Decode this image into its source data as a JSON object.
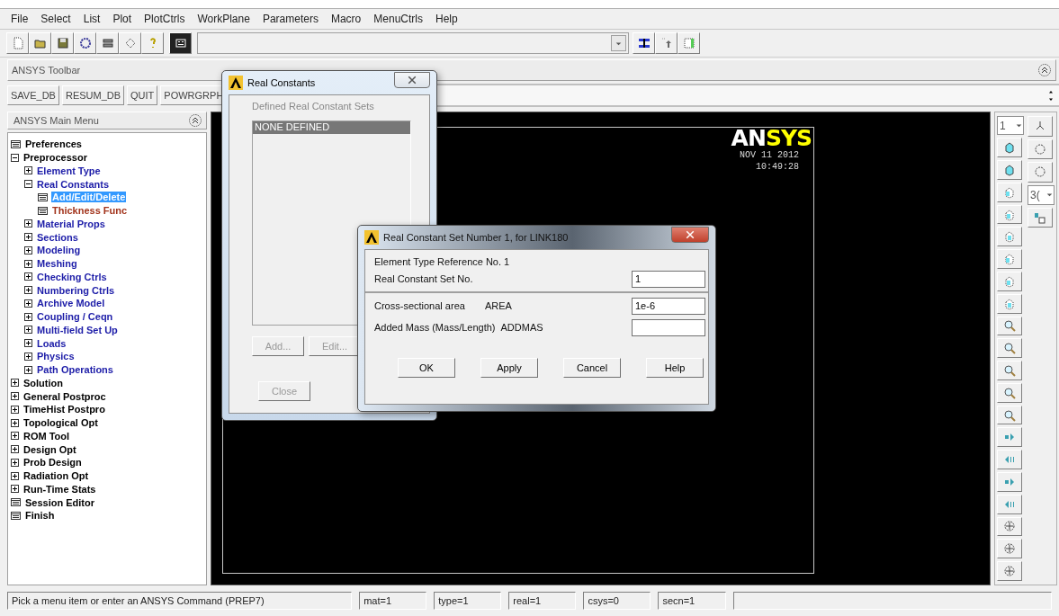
{
  "menu_bar": [
    "File",
    "Select",
    "List",
    "Plot",
    "PlotCtrls",
    "WorkPlane",
    "Parameters",
    "Macro",
    "MenuCtrls",
    "Help"
  ],
  "toolbar_header": "ANSYS Toolbar",
  "toolbar_buttons": [
    "SAVE_DB",
    "RESUM_DB",
    "QUIT",
    "POWRGRPH"
  ],
  "main_menu": {
    "title": "ANSYS Main Menu",
    "items": [
      {
        "label": "Preferences",
        "kind": "action",
        "selected": false,
        "color": "#000000"
      },
      {
        "label": "Preprocessor",
        "kind": "folder",
        "expanded": true,
        "selected": false,
        "color": "#000000",
        "children": [
          {
            "label": "Element Type",
            "kind": "folder",
            "expanded": false,
            "selected": false,
            "color": "#1c1ca8"
          },
          {
            "label": "Real Constants",
            "kind": "folder",
            "expanded": true,
            "selected": false,
            "color": "#1c1ca8",
            "children": [
              {
                "label": "Add/Edit/Delete",
                "kind": "action",
                "selected": true
              },
              {
                "label": "Thickness Func",
                "kind": "action",
                "selected": false,
                "color": "#a2341c"
              }
            ]
          },
          {
            "label": "Material Props",
            "kind": "folder",
            "expanded": false,
            "selected": false,
            "color": "#1c1ca8"
          },
          {
            "label": "Sections",
            "kind": "folder",
            "expanded": false,
            "selected": false,
            "color": "#1c1ca8"
          },
          {
            "label": "Modeling",
            "kind": "folder",
            "expanded": false,
            "selected": false,
            "color": "#1c1ca8"
          },
          {
            "label": "Meshing",
            "kind": "folder",
            "expanded": false,
            "selected": false,
            "color": "#1c1ca8"
          },
          {
            "label": "Checking Ctrls",
            "kind": "folder",
            "expanded": false,
            "selected": false,
            "color": "#1c1ca8"
          },
          {
            "label": "Numbering Ctrls",
            "kind": "folder",
            "expanded": false,
            "selected": false,
            "color": "#1c1ca8"
          },
          {
            "label": "Archive Model",
            "kind": "folder",
            "expanded": false,
            "selected": false,
            "color": "#1c1ca8"
          },
          {
            "label": "Coupling / Ceqn",
            "kind": "folder",
            "expanded": false,
            "selected": false,
            "color": "#1c1ca8"
          },
          {
            "label": "Multi-field Set Up",
            "kind": "folder",
            "expanded": false,
            "selected": false,
            "color": "#1c1ca8"
          },
          {
            "label": "Loads",
            "kind": "folder",
            "expanded": false,
            "selected": false,
            "color": "#1c1ca8"
          },
          {
            "label": "Physics",
            "kind": "folder",
            "expanded": false,
            "selected": false,
            "color": "#1c1ca8"
          },
          {
            "label": "Path Operations",
            "kind": "folder",
            "expanded": false,
            "selected": false,
            "color": "#1c1ca8"
          }
        ]
      },
      {
        "label": "Solution",
        "kind": "folder",
        "expanded": false,
        "selected": false,
        "color": "#000000"
      },
      {
        "label": "General Postproc",
        "kind": "folder",
        "expanded": false,
        "selected": false,
        "color": "#000000"
      },
      {
        "label": "TimeHist Postpro",
        "kind": "folder",
        "expanded": false,
        "selected": false,
        "color": "#000000"
      },
      {
        "label": "Topological Opt",
        "kind": "folder",
        "expanded": false,
        "selected": false,
        "color": "#000000"
      },
      {
        "label": "ROM Tool",
        "kind": "folder",
        "expanded": false,
        "selected": false,
        "color": "#000000"
      },
      {
        "label": "Design Opt",
        "kind": "folder",
        "expanded": false,
        "selected": false,
        "color": "#000000"
      },
      {
        "label": "Prob Design",
        "kind": "folder",
        "expanded": false,
        "selected": false,
        "color": "#000000"
      },
      {
        "label": "Radiation Opt",
        "kind": "folder",
        "expanded": false,
        "selected": false,
        "color": "#000000"
      },
      {
        "label": "Run-Time Stats",
        "kind": "folder",
        "expanded": false,
        "selected": false,
        "color": "#000000"
      },
      {
        "label": "Session Editor",
        "kind": "action",
        "selected": false,
        "color": "#000000"
      },
      {
        "label": "Finish",
        "kind": "action",
        "selected": false,
        "color": "#000000"
      }
    ]
  },
  "graphics": {
    "logo": [
      "AN",
      "SYS"
    ],
    "date": "NOV 11 2012",
    "time": "10:49:28"
  },
  "view_toolbar": {
    "column_1": [
      {
        "kind": "dropdown",
        "value": "1"
      },
      {
        "kind": "button"
      },
      {
        "kind": "button"
      },
      {
        "kind": "button"
      },
      {
        "kind": "button"
      },
      {
        "kind": "button"
      },
      {
        "kind": "button"
      },
      {
        "kind": "button"
      },
      {
        "kind": "button"
      },
      {
        "kind": "button"
      },
      {
        "kind": "button"
      },
      {
        "kind": "button"
      },
      {
        "kind": "button"
      },
      {
        "kind": "button"
      },
      {
        "kind": "button"
      },
      {
        "kind": "button"
      },
      {
        "kind": "button"
      },
      {
        "kind": "button"
      },
      {
        "kind": "button"
      },
      {
        "kind": "button"
      },
      {
        "kind": "button"
      }
    ],
    "column_2": [
      {
        "kind": "button"
      },
      {
        "kind": "button"
      },
      {
        "kind": "button"
      },
      {
        "kind": "dropdown",
        "value": "3("
      },
      {
        "kind": "button"
      }
    ]
  },
  "real_constants_dialog": {
    "title": "Real Constants",
    "heading": "Defined Real Constant Sets",
    "sets": [
      {
        "label": "NONE DEFINED",
        "selected": true
      }
    ],
    "buttons": [
      {
        "label": "Add...",
        "disabled": true
      },
      {
        "label": "Edit...",
        "disabled": true
      }
    ],
    "close_button": {
      "label": "Close",
      "disabled": true
    }
  },
  "set_dialog": {
    "title": "Real Constant Set Number 1, for LINK180",
    "info": "Element Type Reference No. 1",
    "set_number": {
      "label": "Real Constant Set No.",
      "value": "1"
    },
    "constants": [
      {
        "label": "Cross-sectional area",
        "symbol": "AREA",
        "value": "1e-6"
      },
      {
        "label": "Added Mass (Mass/Length)",
        "symbol": "ADDMAS"
      }
    ],
    "buttons": [
      "OK",
      "Apply",
      "Cancel",
      "Help"
    ]
  },
  "status_bar": {
    "message": "Pick a menu item or enter an ANSYS Command (PREP7)",
    "fields": [
      "mat=1",
      "type=1",
      "real=1",
      "csys=0",
      "secn=1"
    ]
  }
}
